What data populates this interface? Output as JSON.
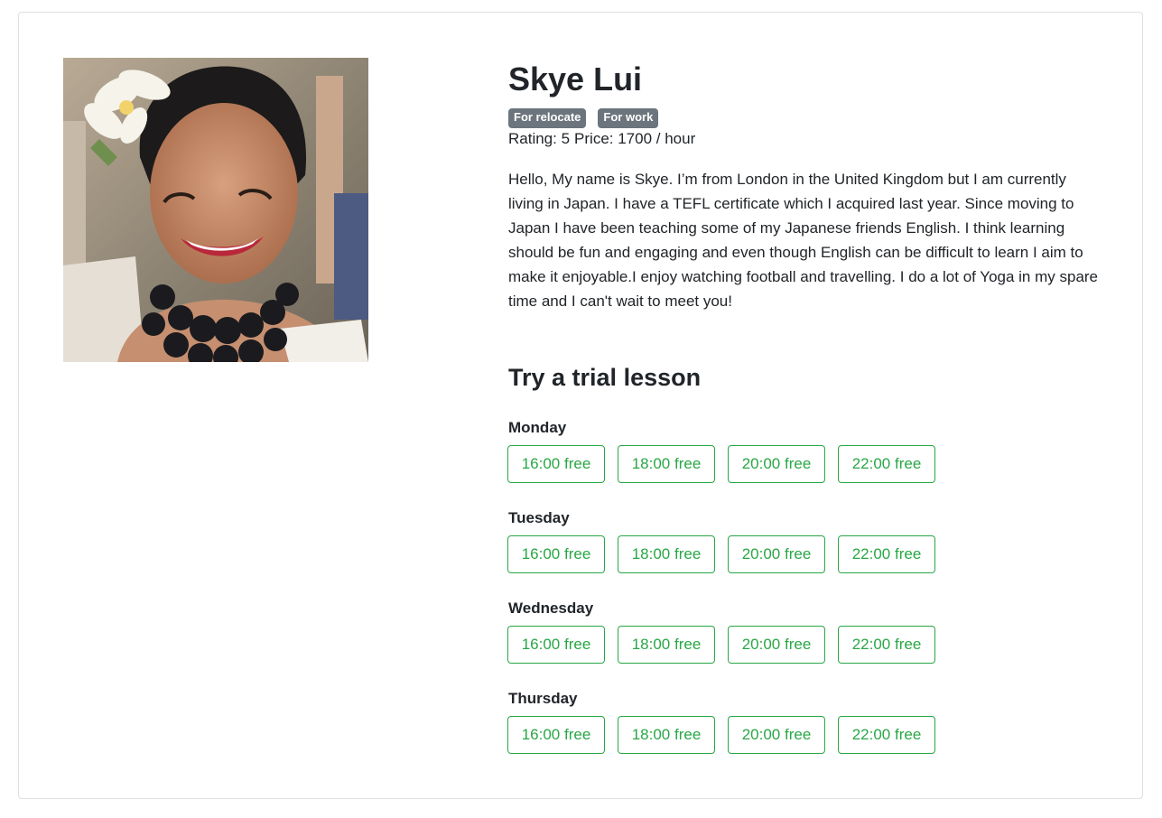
{
  "tutor": {
    "name": "Skye Lui",
    "badges": [
      "For relocate",
      "For work"
    ],
    "rating_text": "Rating: 5",
    "price_text": "Price: 1700 / hour",
    "bio": "Hello, My name is Skye. I’m from London in the United Kingdom but I am currently living in Japan. I have a TEFL certificate which I acquired last year. Since moving to Japan I have been teaching some of my Japanese friends English. I think learning should be fun and engaging and even though English can be difficult to learn I aim to make it enjoyable.I enjoy watching football and travelling. I do a lot of Yoga in my spare time and I can't wait to meet you!"
  },
  "trial": {
    "title": "Try a trial lesson",
    "days": [
      {
        "label": "Monday",
        "slots": [
          "16:00 free",
          "18:00 free",
          "20:00 free",
          "22:00 free"
        ]
      },
      {
        "label": "Tuesday",
        "slots": [
          "16:00 free",
          "18:00 free",
          "20:00 free",
          "22:00 free"
        ]
      },
      {
        "label": "Wednesday",
        "slots": [
          "16:00 free",
          "18:00 free",
          "20:00 free",
          "22:00 free"
        ]
      },
      {
        "label": "Thursday",
        "slots": [
          "16:00 free",
          "18:00 free",
          "20:00 free",
          "22:00 free"
        ]
      }
    ]
  },
  "colors": {
    "slot_accent": "#28a745",
    "badge_bg": "#6c757d"
  }
}
